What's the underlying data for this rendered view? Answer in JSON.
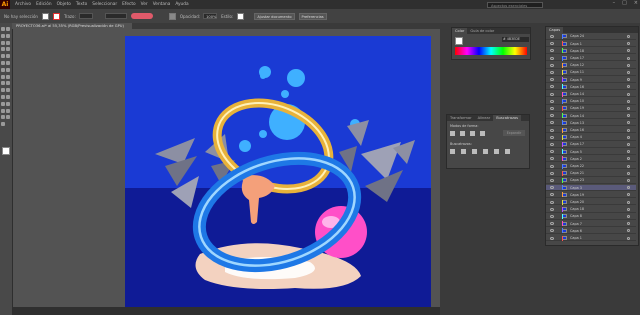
{
  "app": {
    "logo": "Ai"
  },
  "menu": {
    "items": [
      "Archivo",
      "Edición",
      "Objeto",
      "Texto",
      "Seleccionar",
      "Efecto",
      "Ver",
      "Ventana",
      "Ayuda"
    ]
  },
  "search": {
    "placeholder": "Aspectos esenciales clásicos"
  },
  "controlbar": {
    "selection": "No hay selección",
    "stroke_label": "Trazo:",
    "opacity_label": "Opacidad:",
    "opacity_value": "100%",
    "style_label": "Estilo:",
    "align_doc": "Ajustar documento",
    "prefs": "Preferencias"
  },
  "document": {
    "tab": "PROYECTO36.ai* al 55,35% (RGB/Previsualización de GPU)"
  },
  "panels": {
    "color_tabs": [
      "Color",
      "Guía de color"
    ],
    "color_hex": "# 4B3EDE",
    "pathfinder_tabs": [
      "Transformar",
      "Alinear",
      "Buscatrazos"
    ],
    "pathfinder_modes": "Modos de forma:",
    "pathfinder_finders": "Buscatrazos:",
    "pathfinder_expand": "Expandir",
    "layers_tab": "Capas"
  },
  "layers": [
    {
      "name": "Capa 24",
      "color": "#4f7fff"
    },
    {
      "name": "Capa 1",
      "color": "#ff4f4f"
    },
    {
      "name": "Capa 18",
      "color": "#4fff4f"
    },
    {
      "name": "Capa 17",
      "color": "#4f7fff"
    },
    {
      "name": "Capa 12",
      "color": "#ff9f3f"
    },
    {
      "name": "Capa 11",
      "color": "#dfdf3f"
    },
    {
      "name": "Capa 9",
      "color": "#bf4fff"
    },
    {
      "name": "Capa 16",
      "color": "#4fffff"
    },
    {
      "name": "Capa 14",
      "color": "#ff4fbf"
    },
    {
      "name": "Capa 10",
      "color": "#4f7fff"
    },
    {
      "name": "Capa 19",
      "color": "#ff4f4f"
    },
    {
      "name": "Capa 14",
      "color": "#4fff4f"
    },
    {
      "name": "Capa 13",
      "color": "#4f7fff"
    },
    {
      "name": "Capa 16",
      "color": "#ff9f3f"
    },
    {
      "name": "Capa 4",
      "color": "#dfdf3f"
    },
    {
      "name": "Capa 17",
      "color": "#bf4fff"
    },
    {
      "name": "Capa 5",
      "color": "#4fffff"
    },
    {
      "name": "Capa 2",
      "color": "#ff4fbf"
    },
    {
      "name": "Capa 22",
      "color": "#4f7fff"
    },
    {
      "name": "Capa 21",
      "color": "#ff4f4f"
    },
    {
      "name": "Capa 23",
      "color": "#4fff4f"
    },
    {
      "name": "Capa 3",
      "color": "#4f7fff"
    },
    {
      "name": "Capa 19",
      "color": "#ff9f3f"
    },
    {
      "name": "Capa 20",
      "color": "#dfdf3f"
    },
    {
      "name": "Capa 18",
      "color": "#bf4fff"
    },
    {
      "name": "Capa 8",
      "color": "#4fffff"
    },
    {
      "name": "Capa 7",
      "color": "#ff4fbf"
    },
    {
      "name": "Capa 6",
      "color": "#4f7fff"
    },
    {
      "name": "Capa 1",
      "color": "#ff4f4f"
    }
  ],
  "colors": {
    "art_sky": "#1a3ad4",
    "art_floor": "#0f1b96",
    "ring_gold": "#e8b23a",
    "ring_blue": "#1e78e6",
    "bubble": "#3fb0ff",
    "sphere": "#ff4fc8",
    "shard": "#8c8fa3",
    "accent_fill": "#ffffff"
  }
}
